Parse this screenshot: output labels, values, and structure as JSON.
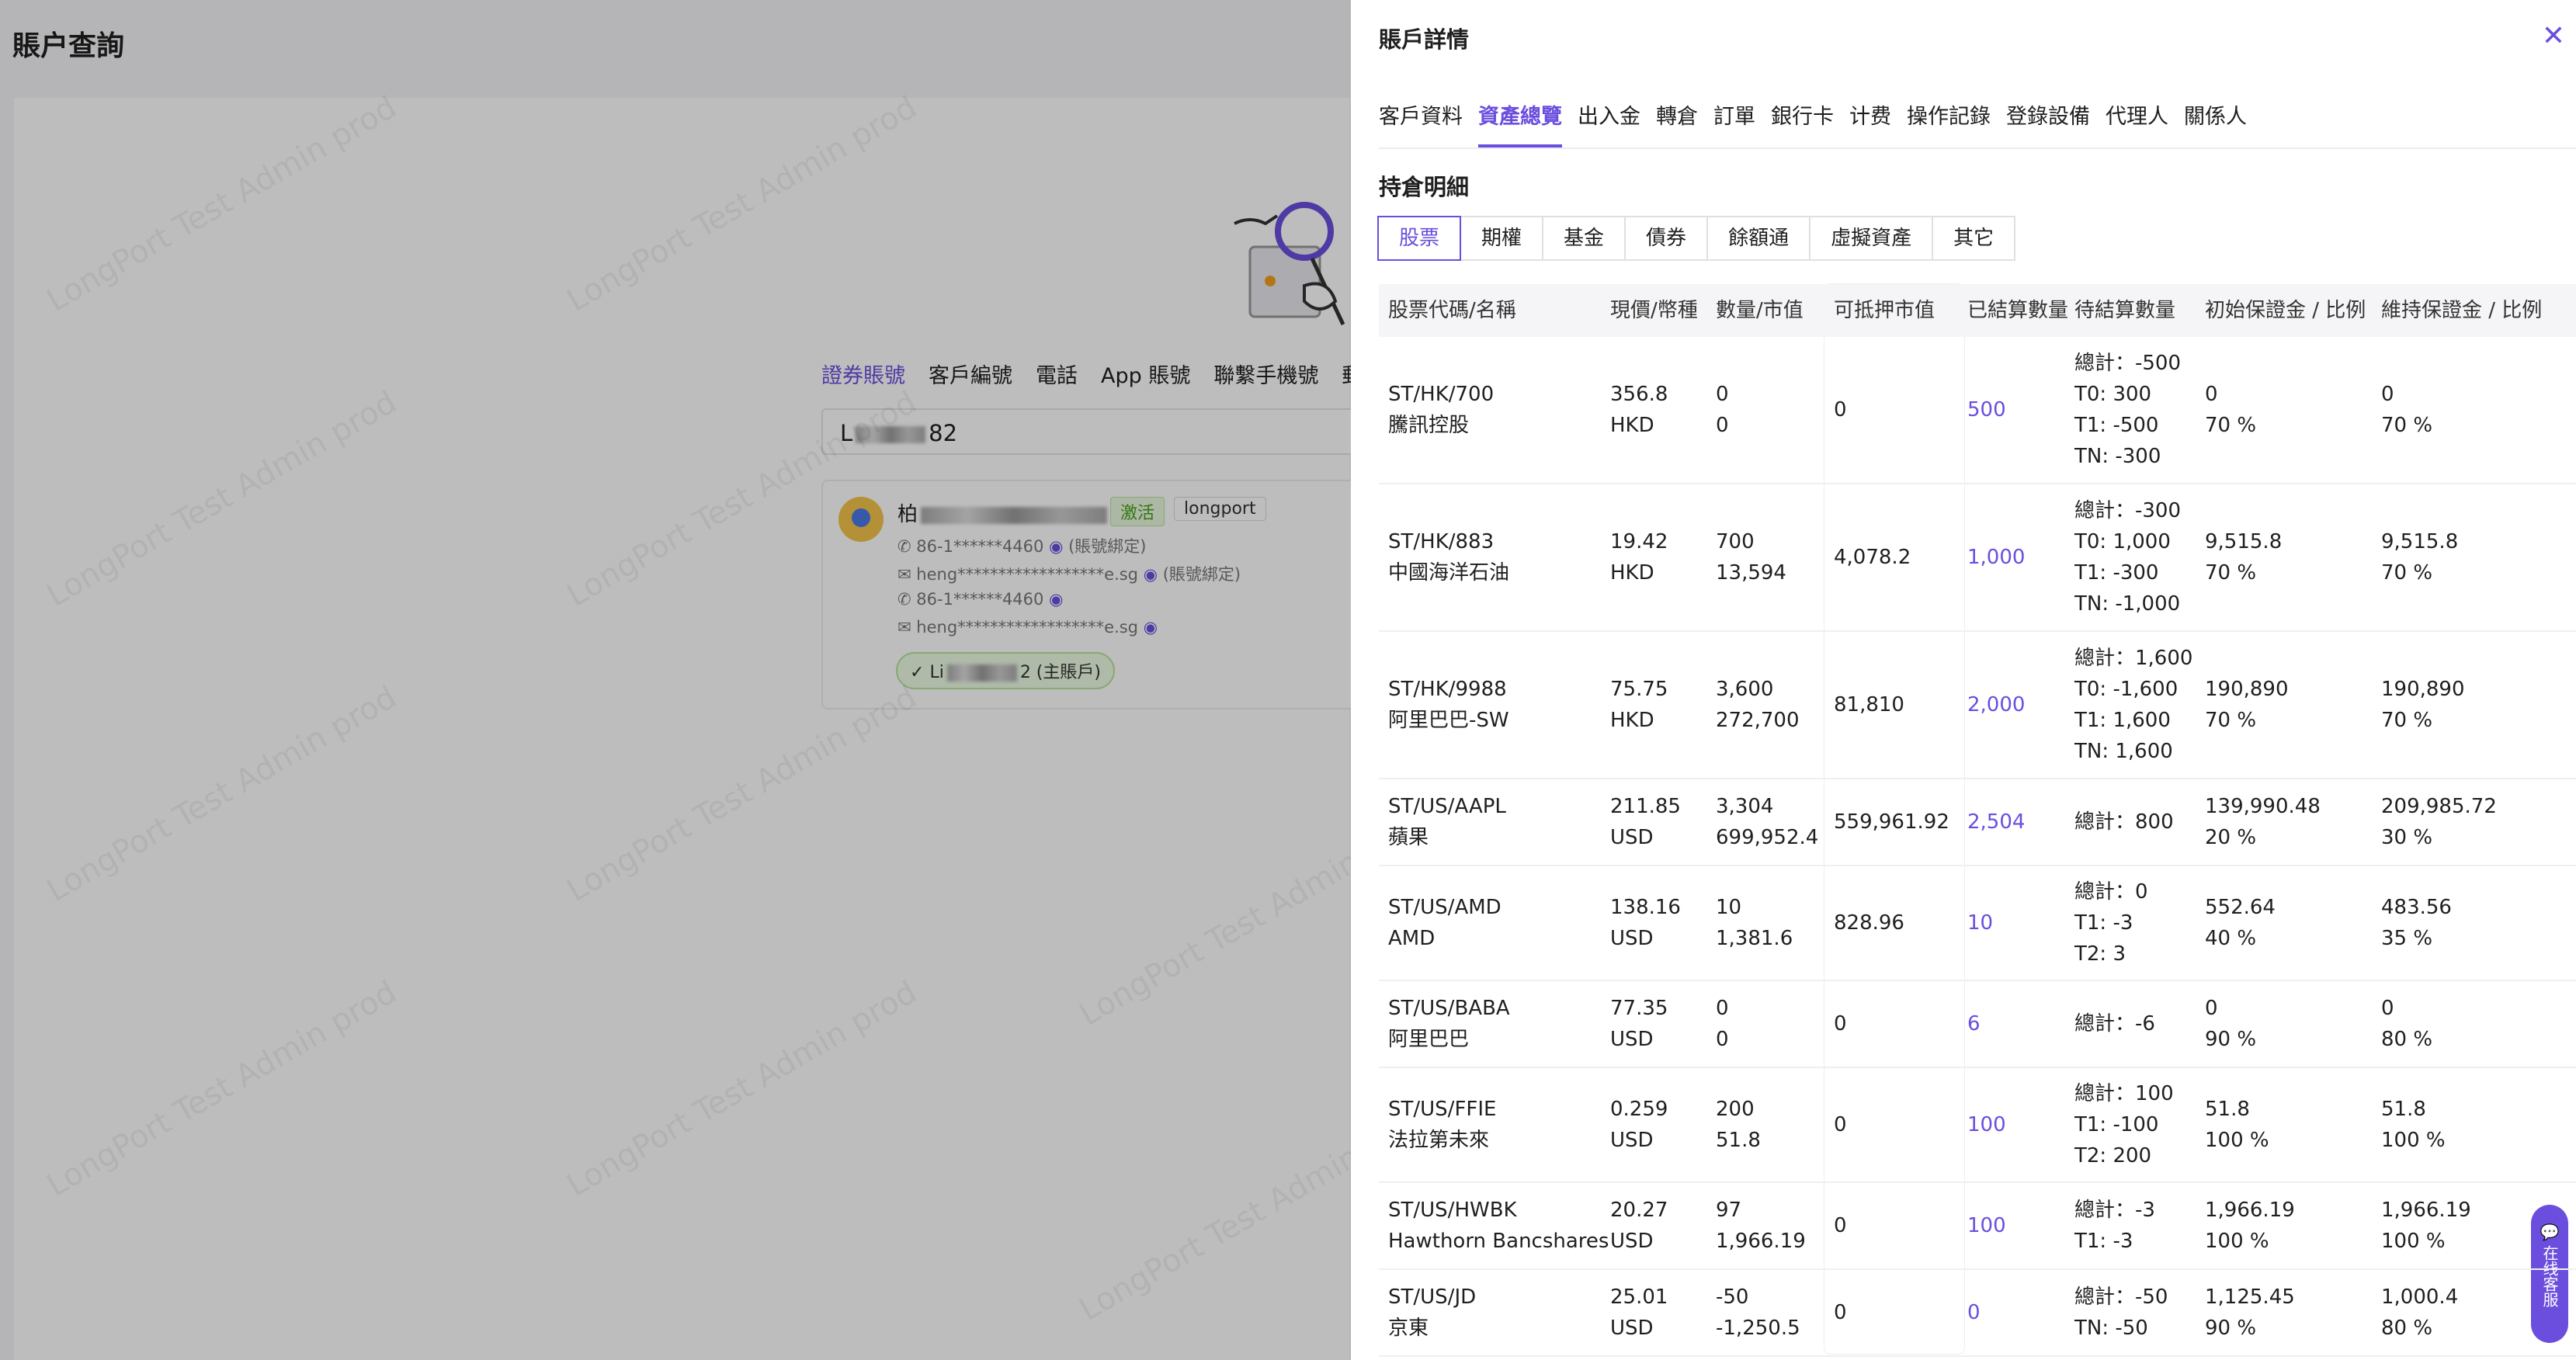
{
  "page": {
    "title": "賬户查詢",
    "watermark": "LongPort Test Admin prod"
  },
  "search": {
    "tabs": [
      "證券賬號",
      "客戶編號",
      "電話",
      "App 賬號",
      "聯繫手機號",
      "郵件"
    ],
    "active_tab": 0,
    "input_prefix": "L",
    "input_suffix": "82"
  },
  "result": {
    "name_prefix": "柏",
    "name_suffix": "G)",
    "status_badge": "激活",
    "brand_badge": "longport",
    "phone1": "86-1******4460",
    "phone1_tag": "(賬號綁定)",
    "email1": "heng******************e.sg",
    "email1_tag": "(賬號綁定)",
    "phone2": "86-1******4460",
    "email2": "heng******************e.sg",
    "account_prefix": "Li",
    "account_suffix": "2 (主賬戶)"
  },
  "drawer": {
    "title": "賬戶詳情",
    "tabs": [
      "客戶資料",
      "資產總覽",
      "出入金",
      "轉倉",
      "訂單",
      "銀行卡",
      "计费",
      "操作記錄",
      "登錄設備",
      "代理人",
      "關係人"
    ],
    "active_tab": 1,
    "section_title": "持倉明細",
    "asset_types": [
      "股票",
      "期權",
      "基金",
      "債券",
      "餘額通",
      "虛擬資產",
      "其它"
    ],
    "active_asset_type": 0,
    "columns": [
      "股票代碼/名稱",
      "現價/幣種",
      "數量/市值",
      "可抵押市值",
      "已結算數量",
      "待結算數量",
      "初始保證金 / 比例",
      "維持保證金 / 比例"
    ],
    "rows": [
      {
        "code": "ST/HK/700",
        "name": "騰訊控股",
        "price": "356.8",
        "currency": "HKD",
        "qty": "0",
        "mv": "0",
        "collateral": "0",
        "settled": "500",
        "pending": [
          "總計：-500",
          "T0: 300",
          "T1: -500",
          "TN: -300"
        ],
        "im": "0",
        "im_ratio": "70 %",
        "mm": "0",
        "mm_ratio": "70 %"
      },
      {
        "code": "ST/HK/883",
        "name": "中國海洋石油",
        "price": "19.42",
        "currency": "HKD",
        "qty": "700",
        "mv": "13,594",
        "collateral": "4,078.2",
        "settled": "1,000",
        "pending": [
          "總計：-300",
          "T0: 1,000",
          "T1: -300",
          "TN: -1,000"
        ],
        "im": "9,515.8",
        "im_ratio": "70 %",
        "mm": "9,515.8",
        "mm_ratio": "70 %"
      },
      {
        "code": "ST/HK/9988",
        "name": "阿里巴巴-SW",
        "price": "75.75",
        "currency": "HKD",
        "qty": "3,600",
        "mv": "272,700",
        "collateral": "81,810",
        "settled": "2,000",
        "pending": [
          "總計：1,600",
          "T0: -1,600",
          "T1: 1,600",
          "TN: 1,600"
        ],
        "im": "190,890",
        "im_ratio": "70 %",
        "mm": "190,890",
        "mm_ratio": "70 %"
      },
      {
        "code": "ST/US/AAPL",
        "name": "蘋果",
        "price": "211.85",
        "currency": "USD",
        "qty": "3,304",
        "mv": "699,952.4",
        "collateral": "559,961.92",
        "settled": "2,504",
        "pending": [
          "總計：800"
        ],
        "im": "139,990.48",
        "im_ratio": "20 %",
        "mm": "209,985.72",
        "mm_ratio": "30 %"
      },
      {
        "code": "ST/US/AMD",
        "name": "AMD",
        "price": "138.16",
        "currency": "USD",
        "qty": "10",
        "mv": "1,381.6",
        "collateral": "828.96",
        "settled": "10",
        "pending": [
          "總計：0",
          "T1: -3",
          "T2: 3"
        ],
        "im": "552.64",
        "im_ratio": "40 %",
        "mm": "483.56",
        "mm_ratio": "35 %"
      },
      {
        "code": "ST/US/BABA",
        "name": "阿里巴巴",
        "price": "77.35",
        "currency": "USD",
        "qty": "0",
        "mv": "0",
        "collateral": "0",
        "settled": "6",
        "pending": [
          "總計：-6"
        ],
        "im": "0",
        "im_ratio": "90 %",
        "mm": "0",
        "mm_ratio": "80 %"
      },
      {
        "code": "ST/US/FFIE",
        "name": "法拉第未來",
        "price": "0.259",
        "currency": "USD",
        "qty": "200",
        "mv": "51.8",
        "collateral": "0",
        "settled": "100",
        "pending": [
          "總計：100",
          "T1: -100",
          "T2: 200"
        ],
        "im": "51.8",
        "im_ratio": "100 %",
        "mm": "51.8",
        "mm_ratio": "100 %"
      },
      {
        "code": "ST/US/HWBK",
        "name": "Hawthorn Bancshares",
        "price": "20.27",
        "currency": "USD",
        "qty": "97",
        "mv": "1,966.19",
        "collateral": "0",
        "settled": "100",
        "pending": [
          "總計：-3",
          "T1: -3"
        ],
        "im": "1,966.19",
        "im_ratio": "100 %",
        "mm": "1,966.19",
        "mm_ratio": "100 %"
      },
      {
        "code": "ST/US/JD",
        "name": "京東",
        "price": "25.01",
        "currency": "USD",
        "qty": "-50",
        "mv": "-1,250.5",
        "collateral": "0",
        "settled": "0",
        "pending": [
          "總計：-50",
          "TN: -50"
        ],
        "im": "1,125.45",
        "im_ratio": "90 %",
        "mm": "1,000.4",
        "mm_ratio": "80 %"
      }
    ]
  },
  "chat_button": "在线客服",
  "colors": {
    "accent": "#6b4ede",
    "active_green": "#46a21c"
  }
}
